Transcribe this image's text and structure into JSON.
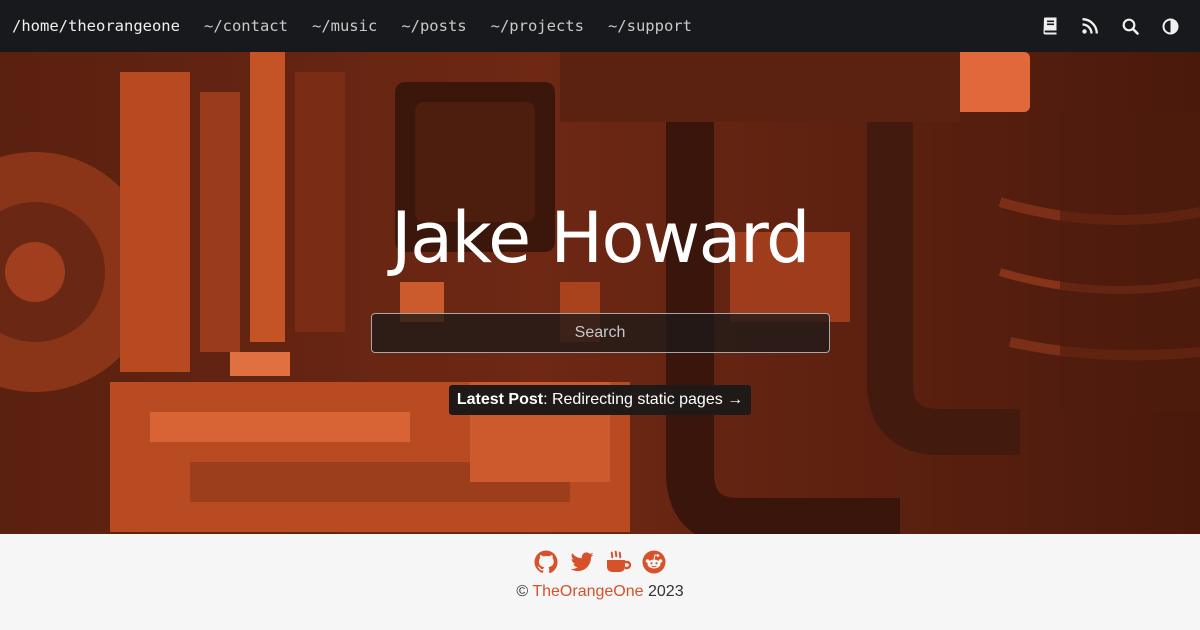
{
  "navbar": {
    "brand": "/home/theorangeone",
    "links": [
      "~/contact",
      "~/music",
      "~/posts",
      "~/projects",
      "~/support"
    ],
    "icons": [
      "book-icon",
      "rss-icon",
      "search-icon",
      "theme-toggle-icon"
    ]
  },
  "hero": {
    "title": "Jake Howard",
    "search_placeholder": "Search",
    "latest_post_label": "Latest Post",
    "latest_post_title": ": Redirecting static pages →"
  },
  "footer": {
    "social_icons": [
      "github-icon",
      "twitter-icon",
      "coffee-icon",
      "reddit-icon"
    ],
    "copyright_symbol": "©",
    "site_name": "TheOrangeOne",
    "year": "2023"
  },
  "colors": {
    "accent": "#d7512b",
    "navbar_bg": "#17191c",
    "footer_bg": "#f6f6f6"
  }
}
